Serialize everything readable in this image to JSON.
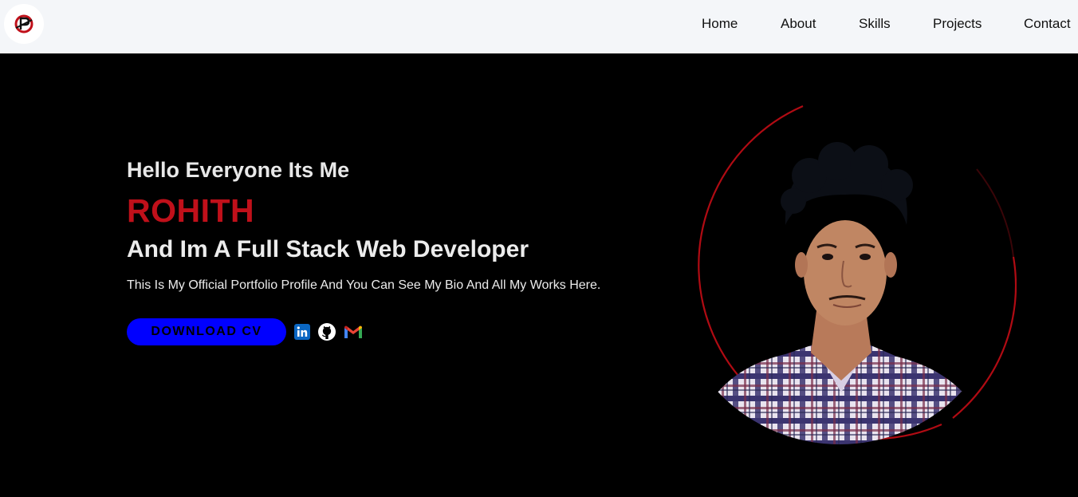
{
  "nav": {
    "logo_icon": "brand-logo-icon",
    "links": [
      "Home",
      "About",
      "Skills",
      "Projects",
      "Contact"
    ]
  },
  "hero": {
    "greeting": "Hello Everyone Its Me",
    "name": "ROHITH",
    "role": "And Im A Full Stack Web Developer",
    "bio": "This Is My Official Portfolio Profile And You Can See My Bio And All My Works Here.",
    "cv_button": "DOWNLOAD CV",
    "social_icons": [
      "linkedin-icon",
      "github-icon",
      "gmail-icon"
    ],
    "portrait_icon": "profile-photo"
  },
  "colors": {
    "accent": "#c0101a",
    "button": "#0000ff",
    "nav_bg": "#f4f6f9",
    "hero_bg": "#000000"
  }
}
